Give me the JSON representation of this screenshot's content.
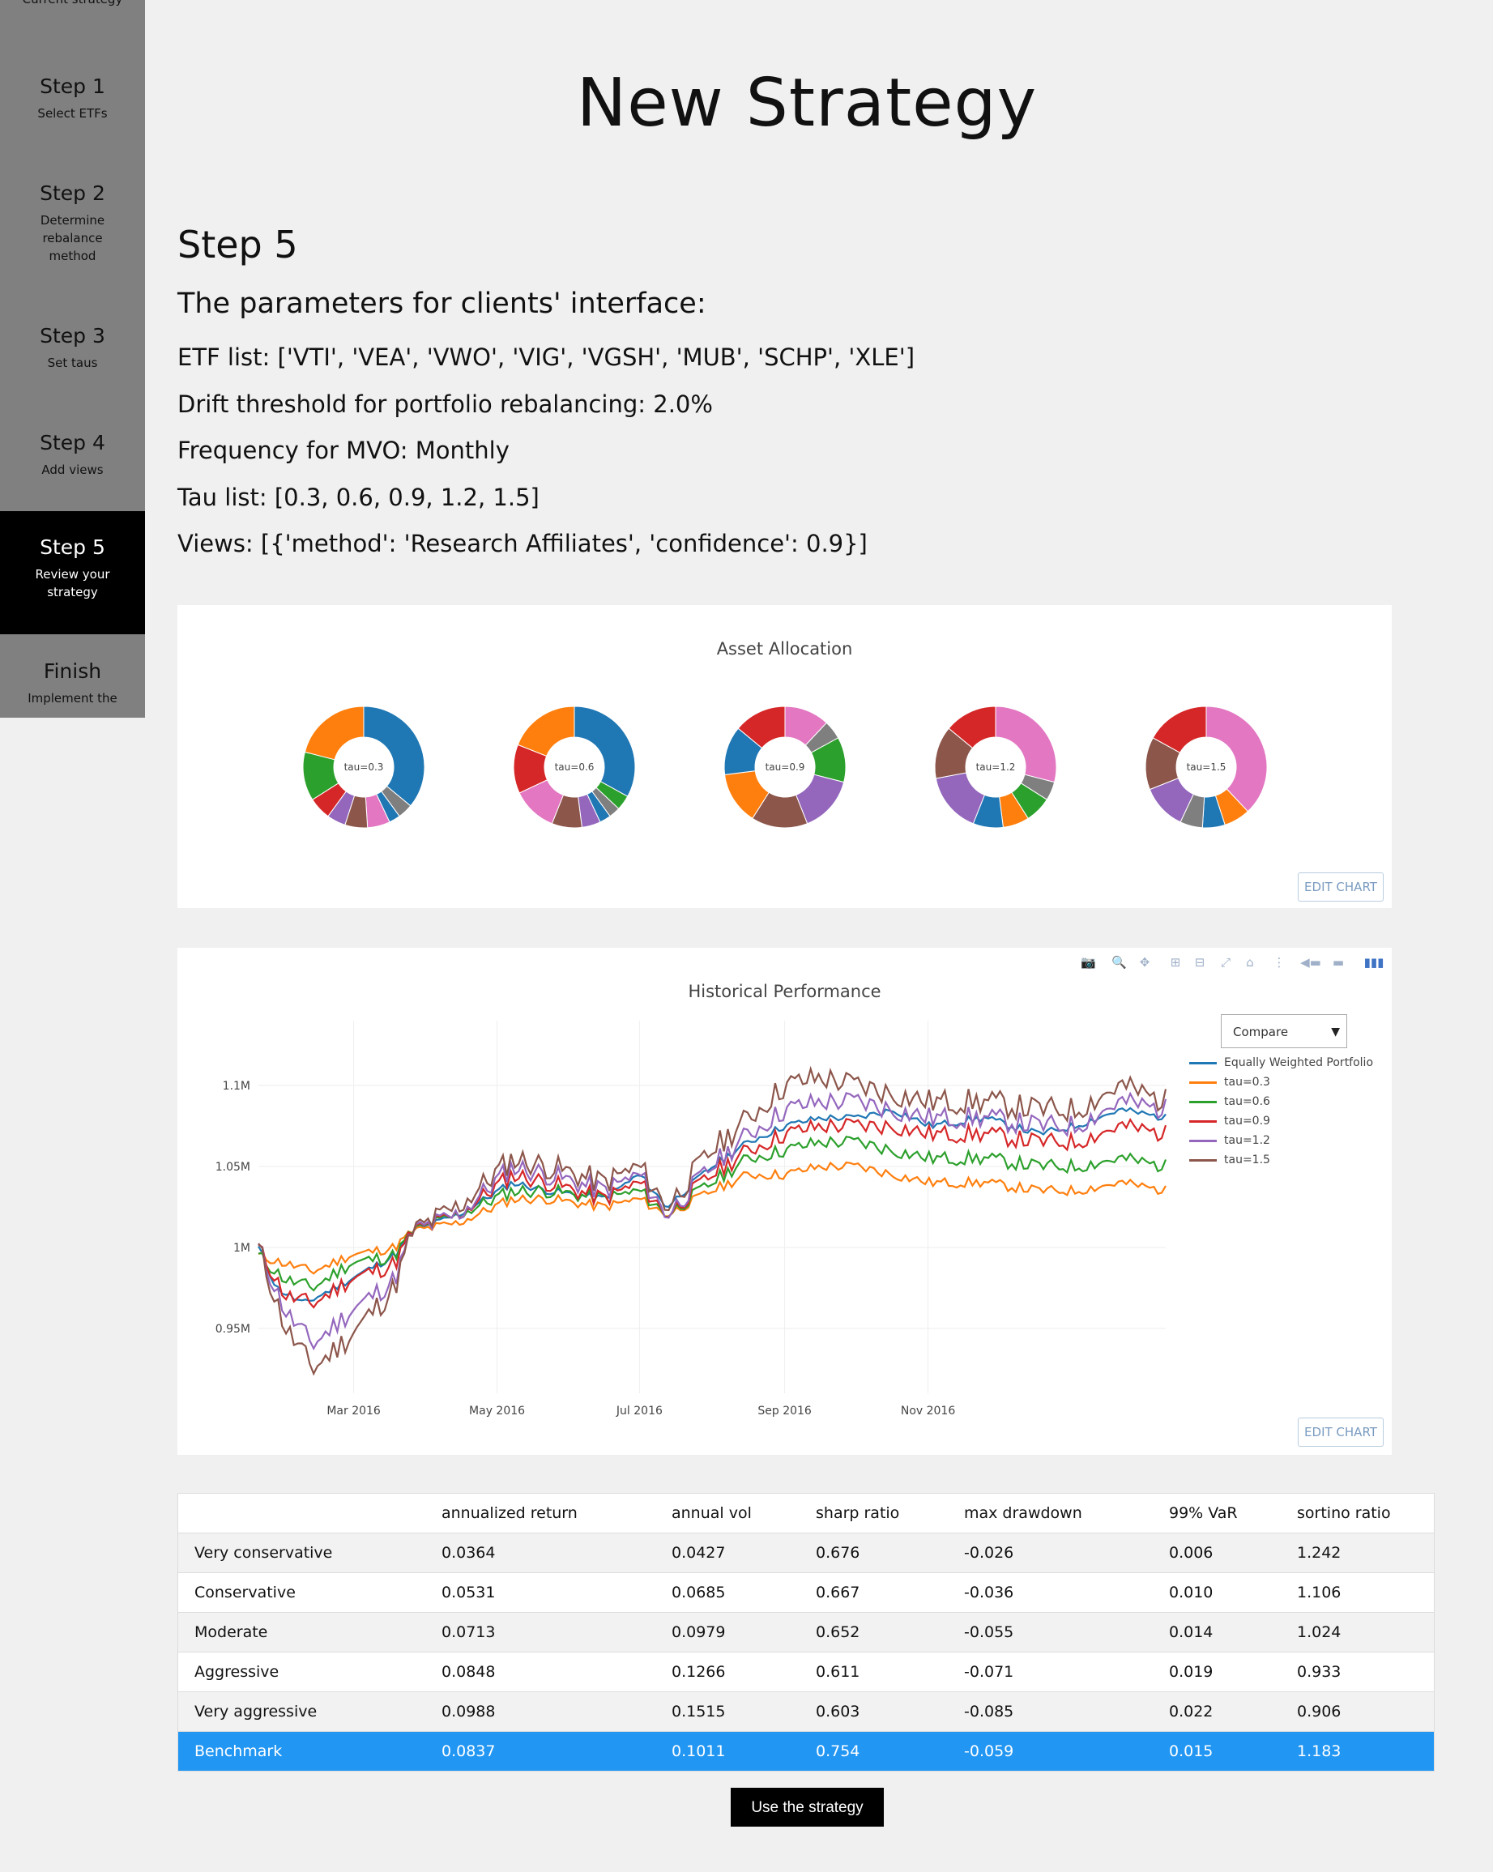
{
  "sidebar": {
    "cut_text": "Current strategy",
    "steps": [
      {
        "title": "Step 1",
        "desc": "Select ETFs"
      },
      {
        "title": "Step 2",
        "desc": "Determine rebalance method"
      },
      {
        "title": "Step 3",
        "desc": "Set taus"
      },
      {
        "title": "Step 4",
        "desc": "Add views"
      },
      {
        "title": "Step 5",
        "desc": "Review your strategy"
      },
      {
        "title": "Finish",
        "desc": "Implement the"
      }
    ],
    "active_step": "Step 5"
  },
  "page": {
    "title": "New Strategy",
    "step_heading": "Step 5",
    "params_heading": "The parameters for clients' interface:",
    "params": [
      "ETF list: ['VTI', 'VEA', 'VWO', 'VIG', 'VGSH', 'MUB', 'SCHP', 'XLE']",
      "Drift threshold for portfolio rebalancing: 2.0%",
      "Frequency for MVO: Monthly",
      "Tau list: [0.3, 0.6, 0.9, 1.2, 1.5]",
      "Views: [{'method': 'Research Affiliates', 'confidence': 0.9}]"
    ]
  },
  "allocation_chart": {
    "title": "Asset Allocation",
    "edit_label": "EDIT CHART",
    "palette": [
      "#1f77b4",
      "#ff7f0e",
      "#2ca02c",
      "#d62728",
      "#9467bd",
      "#8c564b",
      "#e377c2",
      "#7f7f7f"
    ],
    "labels": [
      "tau=0.3",
      "tau=0.6",
      "tau=0.9",
      "tau=1.2",
      "tau=1.5"
    ]
  },
  "chart_data": [
    {
      "type": "pie",
      "title": "Asset Allocation",
      "hole": true,
      "palette": [
        "#1f77b4",
        "#ff7f0e",
        "#2ca02c",
        "#d62728",
        "#9467bd",
        "#8c564b",
        "#e377c2",
        "#7f7f7f"
      ],
      "donuts": [
        {
          "label": "tau=0.3",
          "slices": [
            [
              "#1f77b4",
              36
            ],
            [
              "#7f7f7f",
              4
            ],
            [
              "#1f77b4",
              3
            ],
            [
              "#e377c2",
              6
            ],
            [
              "#8c564b",
              6
            ],
            [
              "#9467bd",
              5
            ],
            [
              "#d62728",
              6
            ],
            [
              "#2ca02c",
              13
            ],
            [
              "#ff7f0e",
              21
            ]
          ]
        },
        {
          "label": "tau=0.6",
          "slices": [
            [
              "#1f77b4",
              33
            ],
            [
              "#2ca02c",
              4
            ],
            [
              "#7f7f7f",
              3
            ],
            [
              "#1f77b4",
              3
            ],
            [
              "#9467bd",
              5
            ],
            [
              "#8c564b",
              8
            ],
            [
              "#e377c2",
              12
            ],
            [
              "#d62728",
              13
            ],
            [
              "#ff7f0e",
              19
            ]
          ]
        },
        {
          "label": "tau=0.9",
          "slices": [
            [
              "#e377c2",
              12
            ],
            [
              "#7f7f7f",
              5
            ],
            [
              "#2ca02c",
              12
            ],
            [
              "#9467bd",
              15
            ],
            [
              "#8c564b",
              15
            ],
            [
              "#ff7f0e",
              14
            ],
            [
              "#1f77b4",
              13
            ],
            [
              "#d62728",
              14
            ]
          ]
        },
        {
          "label": "tau=1.2",
          "slices": [
            [
              "#e377c2",
              29
            ],
            [
              "#7f7f7f",
              5
            ],
            [
              "#2ca02c",
              7
            ],
            [
              "#ff7f0e",
              7
            ],
            [
              "#1f77b4",
              8
            ],
            [
              "#9467bd",
              16
            ],
            [
              "#8c564b",
              14
            ],
            [
              "#d62728",
              14
            ]
          ]
        },
        {
          "label": "tau=1.5",
          "slices": [
            [
              "#e377c2",
              38
            ],
            [
              "#ff7f0e",
              7
            ],
            [
              "#1f77b4",
              6
            ],
            [
              "#7f7f7f",
              6
            ],
            [
              "#9467bd",
              12
            ],
            [
              "#8c564b",
              14
            ],
            [
              "#d62728",
              17
            ]
          ]
        }
      ]
    },
    {
      "type": "line",
      "title": "Historical Performance",
      "x_start": "2016-01-29",
      "x_end": "2016-12-30",
      "x_ticks": [
        "Mar 2016",
        "May 2016",
        "Jul 2016",
        "Sep 2016",
        "Nov 2016"
      ],
      "y_ticks": [
        "0.95M",
        "1M",
        "1.05M",
        "1.1M"
      ],
      "ylim": [
        0.915,
        1.135
      ],
      "series": [
        {
          "name": "Equally Weighted Portfolio",
          "color": "#1f77b4",
          "anchors": [
            [
              0,
              1.0
            ],
            [
              0.02,
              0.975
            ],
            [
              0.05,
              0.965
            ],
            [
              0.1,
              0.98
            ],
            [
              0.15,
              0.995
            ],
            [
              0.17,
              1.01
            ],
            [
              0.22,
              1.02
            ],
            [
              0.28,
              1.04
            ],
            [
              0.32,
              1.035
            ],
            [
              0.38,
              1.03
            ],
            [
              0.42,
              1.045
            ],
            [
              0.45,
              1.025
            ],
            [
              0.5,
              1.05
            ],
            [
              0.54,
              1.065
            ],
            [
              0.58,
              1.075
            ],
            [
              0.62,
              1.08
            ],
            [
              0.66,
              1.08
            ],
            [
              0.7,
              1.085
            ],
            [
              0.74,
              1.075
            ],
            [
              0.8,
              1.08
            ],
            [
              0.86,
              1.07
            ],
            [
              0.9,
              1.075
            ],
            [
              0.95,
              1.085
            ],
            [
              1.0,
              1.08
            ]
          ]
        },
        {
          "name": "tau=0.3",
          "color": "#ff7f0e",
          "anchors": [
            [
              0,
              0.995
            ],
            [
              0.03,
              0.99
            ],
            [
              0.06,
              0.985
            ],
            [
              0.1,
              0.995
            ],
            [
              0.15,
              1.0
            ],
            [
              0.17,
              1.01
            ],
            [
              0.22,
              1.015
            ],
            [
              0.28,
              1.03
            ],
            [
              0.32,
              1.03
            ],
            [
              0.38,
              1.025
            ],
            [
              0.42,
              1.03
            ],
            [
              0.45,
              1.02
            ],
            [
              0.5,
              1.035
            ],
            [
              0.54,
              1.045
            ],
            [
              0.58,
              1.045
            ],
            [
              0.62,
              1.05
            ],
            [
              0.66,
              1.05
            ],
            [
              0.7,
              1.045
            ],
            [
              0.74,
              1.04
            ],
            [
              0.8,
              1.04
            ],
            [
              0.86,
              1.035
            ],
            [
              0.9,
              1.035
            ],
            [
              0.95,
              1.04
            ],
            [
              1.0,
              1.035
            ]
          ]
        },
        {
          "name": "tau=0.6",
          "color": "#2ca02c",
          "anchors": [
            [
              0,
              0.995
            ],
            [
              0.03,
              0.98
            ],
            [
              0.06,
              0.975
            ],
            [
              0.1,
              0.99
            ],
            [
              0.15,
              0.995
            ],
            [
              0.17,
              1.01
            ],
            [
              0.22,
              1.02
            ],
            [
              0.28,
              1.035
            ],
            [
              0.32,
              1.035
            ],
            [
              0.38,
              1.03
            ],
            [
              0.42,
              1.035
            ],
            [
              0.45,
              1.02
            ],
            [
              0.5,
              1.04
            ],
            [
              0.54,
              1.055
            ],
            [
              0.58,
              1.06
            ],
            [
              0.62,
              1.065
            ],
            [
              0.66,
              1.065
            ],
            [
              0.7,
              1.06
            ],
            [
              0.74,
              1.055
            ],
            [
              0.8,
              1.055
            ],
            [
              0.86,
              1.05
            ],
            [
              0.9,
              1.05
            ],
            [
              0.95,
              1.055
            ],
            [
              1.0,
              1.05
            ]
          ]
        },
        {
          "name": "tau=0.9",
          "color": "#d62728",
          "anchors": [
            [
              0,
              1.0
            ],
            [
              0.03,
              0.97
            ],
            [
              0.06,
              0.965
            ],
            [
              0.1,
              0.98
            ],
            [
              0.15,
              0.99
            ],
            [
              0.17,
              1.01
            ],
            [
              0.22,
              1.02
            ],
            [
              0.28,
              1.045
            ],
            [
              0.32,
              1.04
            ],
            [
              0.38,
              1.03
            ],
            [
              0.42,
              1.04
            ],
            [
              0.45,
              1.02
            ],
            [
              0.5,
              1.045
            ],
            [
              0.54,
              1.06
            ],
            [
              0.58,
              1.07
            ],
            [
              0.62,
              1.075
            ],
            [
              0.66,
              1.075
            ],
            [
              0.7,
              1.075
            ],
            [
              0.74,
              1.07
            ],
            [
              0.8,
              1.07
            ],
            [
              0.86,
              1.065
            ],
            [
              0.9,
              1.065
            ],
            [
              0.95,
              1.075
            ],
            [
              1.0,
              1.07
            ]
          ]
        },
        {
          "name": "tau=1.2",
          "color": "#9467bd",
          "anchors": [
            [
              0,
              1.0
            ],
            [
              0.03,
              0.96
            ],
            [
              0.06,
              0.94
            ],
            [
              0.1,
              0.96
            ],
            [
              0.15,
              0.98
            ],
            [
              0.17,
              1.01
            ],
            [
              0.22,
              1.02
            ],
            [
              0.28,
              1.05
            ],
            [
              0.32,
              1.045
            ],
            [
              0.38,
              1.035
            ],
            [
              0.42,
              1.045
            ],
            [
              0.45,
              1.02
            ],
            [
              0.5,
              1.05
            ],
            [
              0.54,
              1.07
            ],
            [
              0.58,
              1.085
            ],
            [
              0.62,
              1.09
            ],
            [
              0.66,
              1.09
            ],
            [
              0.7,
              1.085
            ],
            [
              0.74,
              1.08
            ],
            [
              0.8,
              1.08
            ],
            [
              0.86,
              1.075
            ],
            [
              0.9,
              1.075
            ],
            [
              0.95,
              1.09
            ],
            [
              1.0,
              1.085
            ]
          ]
        },
        {
          "name": "tau=1.5",
          "color": "#8c564b",
          "anchors": [
            [
              0,
              1.0
            ],
            [
              0.03,
              0.95
            ],
            [
              0.06,
              0.925
            ],
            [
              0.1,
              0.945
            ],
            [
              0.15,
              0.975
            ],
            [
              0.17,
              1.01
            ],
            [
              0.22,
              1.025
            ],
            [
              0.28,
              1.055
            ],
            [
              0.32,
              1.05
            ],
            [
              0.38,
              1.04
            ],
            [
              0.42,
              1.05
            ],
            [
              0.45,
              1.025
            ],
            [
              0.5,
              1.06
            ],
            [
              0.54,
              1.08
            ],
            [
              0.58,
              1.1
            ],
            [
              0.62,
              1.105
            ],
            [
              0.66,
              1.1
            ],
            [
              0.7,
              1.095
            ],
            [
              0.74,
              1.09
            ],
            [
              0.8,
              1.09
            ],
            [
              0.86,
              1.085
            ],
            [
              0.9,
              1.085
            ],
            [
              0.95,
              1.1
            ],
            [
              1.0,
              1.09
            ]
          ]
        }
      ]
    }
  ],
  "performance_chart": {
    "title": "Historical Performance",
    "edit_label": "EDIT CHART",
    "dropdown_value": "Compare",
    "modebar_icons": [
      "camera-icon",
      "zoom-icon",
      "pan-icon",
      "zoom-in-icon",
      "zoom-out-icon",
      "autoscale-icon",
      "home-icon",
      "spike-lines-icon",
      "hover-closest-icon",
      "hover-compare-icon",
      "plotly-logo-icon"
    ]
  },
  "table": {
    "columns": [
      "",
      "annualized return",
      "annual vol",
      "sharp ratio",
      "max drawdown",
      "99% VaR",
      "sortino ratio"
    ],
    "rows": [
      [
        "Very conservative",
        "0.0364",
        "0.0427",
        "0.676",
        "-0.026",
        "0.006",
        "1.242"
      ],
      [
        "Conservative",
        "0.0531",
        "0.0685",
        "0.667",
        "-0.036",
        "0.010",
        "1.106"
      ],
      [
        "Moderate",
        "0.0713",
        "0.0979",
        "0.652",
        "-0.055",
        "0.014",
        "1.024"
      ],
      [
        "Aggressive",
        "0.0848",
        "0.1266",
        "0.611",
        "-0.071",
        "0.019",
        "0.933"
      ],
      [
        "Very aggressive",
        "0.0988",
        "0.1515",
        "0.603",
        "-0.085",
        "0.022",
        "0.906"
      ],
      [
        "Benchmark",
        "0.0837",
        "0.1011",
        "0.754",
        "-0.059",
        "0.015",
        "1.183"
      ]
    ],
    "highlight_row": "Benchmark"
  },
  "action": {
    "use_label": "Use the strategy"
  },
  "colors": {
    "accent": "#2196f3",
    "sidebar": "#808080",
    "active": "#000000"
  }
}
